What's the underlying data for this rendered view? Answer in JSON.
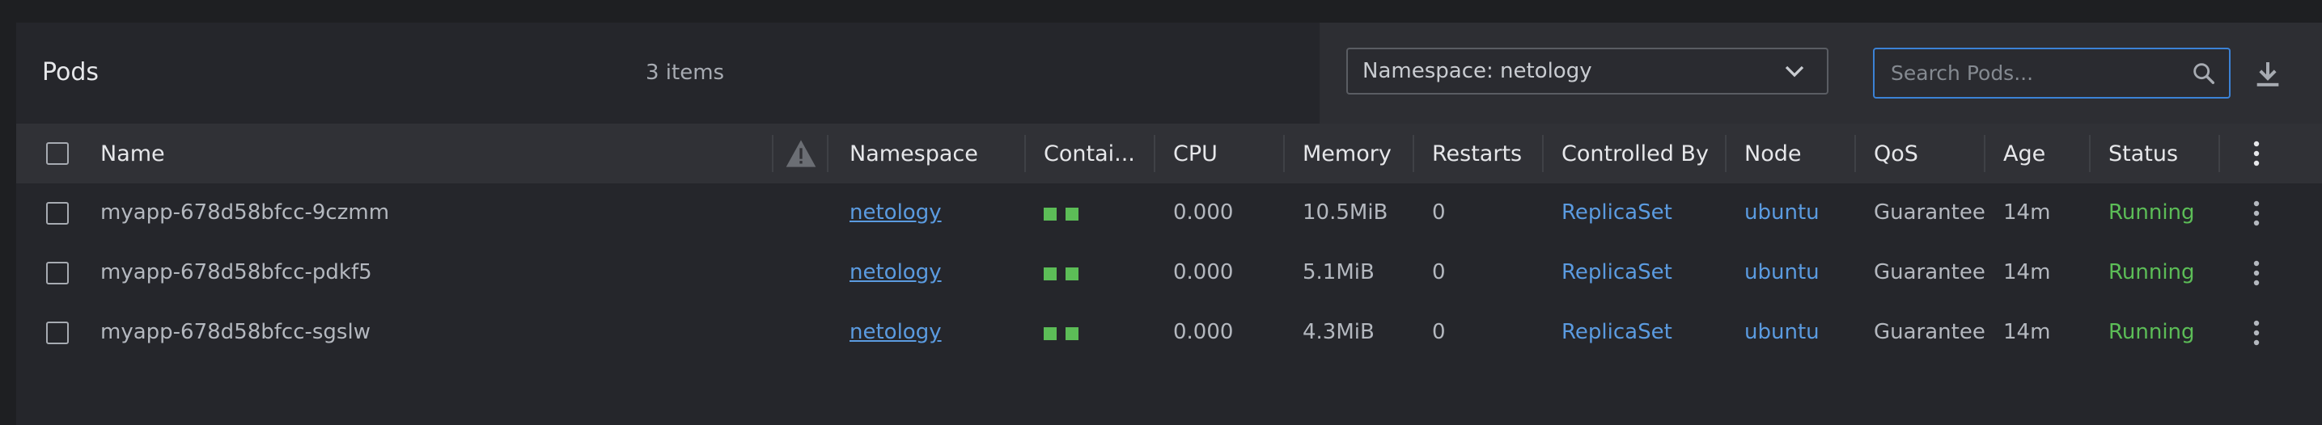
{
  "header": {
    "title": "Pods",
    "items_count": "3 items"
  },
  "filters": {
    "namespace_select_value": "Namespace: netology",
    "search_placeholder": "Search Pods..."
  },
  "table": {
    "columns": [
      "Name",
      "Namespace",
      "Contai...",
      "CPU",
      "Memory",
      "Restarts",
      "Controlled By",
      "Node",
      "QoS",
      "Age",
      "Status"
    ],
    "rows": [
      {
        "name": "myapp-678d58bfcc-9czmm",
        "namespace": "netology",
        "cpu": "0.000",
        "memory": "10.5MiB",
        "restarts": "0",
        "controlled_by": "ReplicaSet",
        "node": "ubuntu",
        "qos": "Guarantee",
        "age": "14m",
        "status": "Running"
      },
      {
        "name": "myapp-678d58bfcc-pdkf5",
        "namespace": "netology",
        "cpu": "0.000",
        "memory": "5.1MiB",
        "restarts": "0",
        "controlled_by": "ReplicaSet",
        "node": "ubuntu",
        "qos": "Guarantee",
        "age": "14m",
        "status": "Running"
      },
      {
        "name": "myapp-678d58bfcc-sgslw",
        "namespace": "netology",
        "cpu": "0.000",
        "memory": "4.3MiB",
        "restarts": "0",
        "controlled_by": "ReplicaSet",
        "node": "ubuntu",
        "qos": "Guarantee",
        "age": "14m",
        "status": "Running"
      }
    ]
  },
  "icons": {
    "warning_column": "warning-icon",
    "search": "search-icon",
    "download": "download-icon",
    "row_menu": "kebab-menu-icon",
    "container_status": "container-status-icon"
  },
  "colors": {
    "running": "#5cbd57",
    "link": "#5b9be0",
    "search_focus": "#3b82d6"
  }
}
